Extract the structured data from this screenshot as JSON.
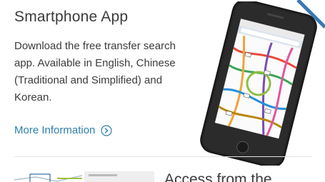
{
  "card": {
    "title": "Smartphone App",
    "description": "Download the free transfer search app. Available in English, Chinese (Traditional and Simplified) and Korean.",
    "link_label": "More Information"
  },
  "next_card": {
    "title_partial": "Access from the"
  },
  "colors": {
    "text": "#3b3b3b",
    "link": "#2e7fae",
    "corner_accent": "#3a78b5",
    "divider": "#e1e1e1"
  },
  "icons": {
    "link_icon": "circle-chevron-right-icon",
    "corner_icon": "corner-arrow-icon"
  }
}
